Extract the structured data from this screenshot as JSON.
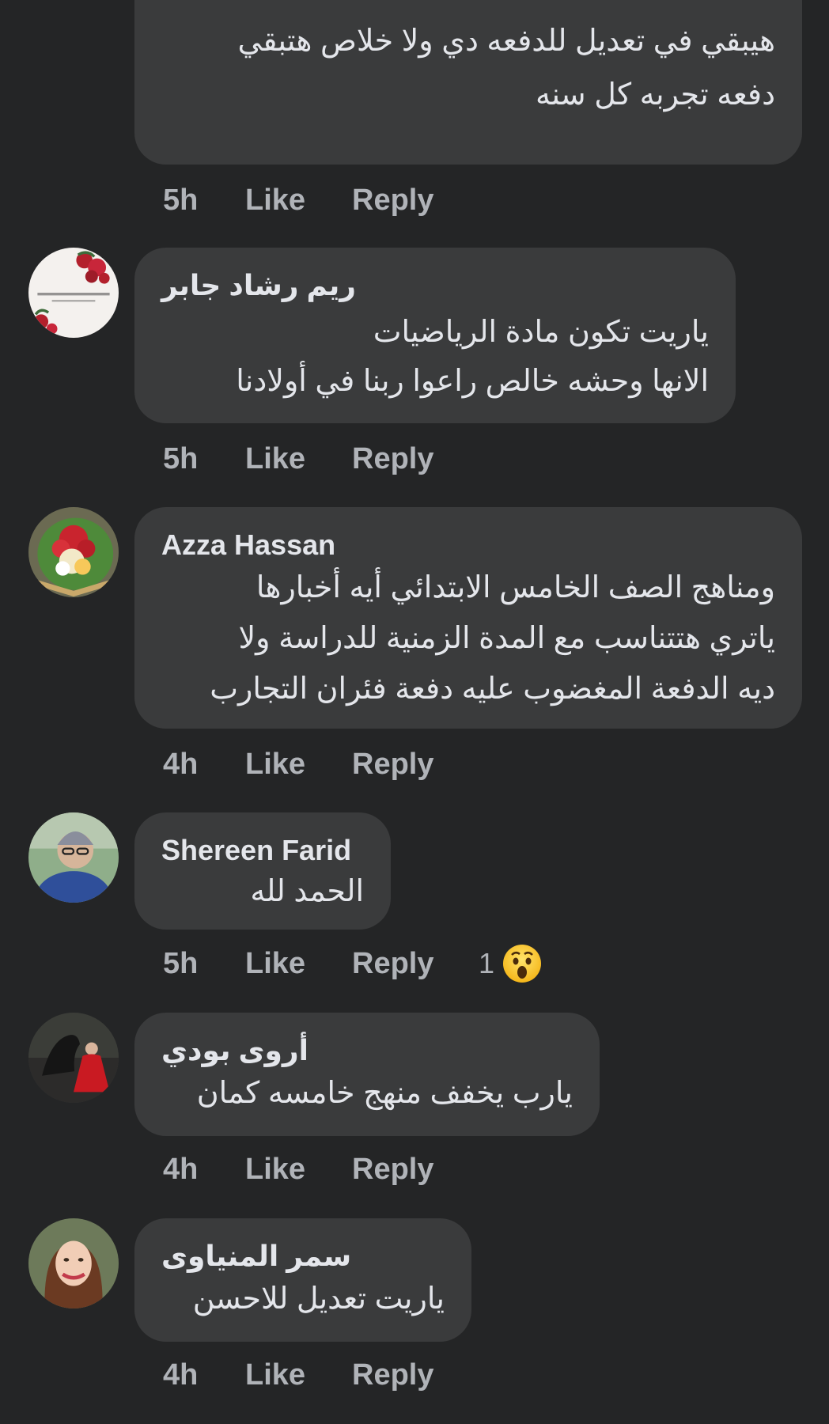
{
  "comments": [
    {
      "author": "",
      "lines": [
        "هيبقي في تعديل للدفعه دي ولا خلاص هتبقي",
        "دفعه تجربه كل سنه"
      ],
      "time": "5h",
      "like": "Like",
      "reply": "Reply"
    },
    {
      "author": "ريم رشاد جابر",
      "lines": [
        "ياريت تكون مادة الرياضيات",
        "الانها وحشه خالص   راعوا ربنا في  أولادنا"
      ],
      "time": "5h",
      "like": "Like",
      "reply": "Reply"
    },
    {
      "author": "Azza Hassan",
      "lines": [
        "ومناهج الصف الخامس الابتدائي أيه أخبارها",
        "ياتري هتتناسب مع المدة الزمنية للدراسة ولا",
        "ديه الدفعة المغضوب عليه دفعة فئران التجارب"
      ],
      "time": "4h",
      "like": "Like",
      "reply": "Reply"
    },
    {
      "author": "Shereen Farid",
      "lines": [
        "الحمد لله"
      ],
      "time": "5h",
      "like": "Like",
      "reply": "Reply",
      "reaction_count": "1",
      "reaction_icon": "wow-emoji-icon"
    },
    {
      "author": "أروى بودي",
      "lines": [
        "يارب يخفف منهج خامسه كمان"
      ],
      "time": "4h",
      "like": "Like",
      "reply": "Reply"
    },
    {
      "author": "سمر المنياوى",
      "lines": [
        "ياريت تعديل للاحسن"
      ],
      "time": "4h",
      "like": "Like",
      "reply": "Reply"
    }
  ],
  "colors": {
    "background": "#242526",
    "bubble": "#3a3b3c",
    "primary_text": "#e4e6eb",
    "secondary_text": "#b0b3b8"
  }
}
